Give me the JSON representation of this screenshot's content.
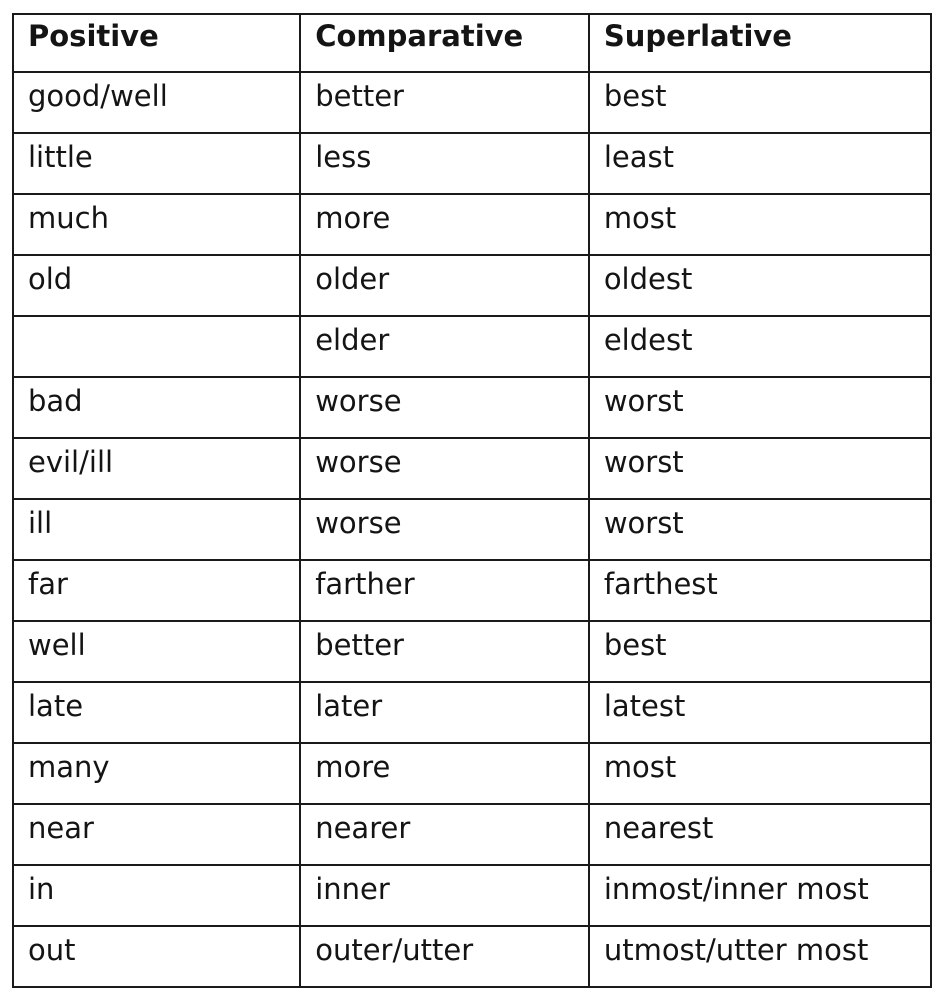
{
  "table": {
    "headers": [
      "Positive",
      "Comparative",
      "Superlative"
    ],
    "rows": [
      [
        "good/well",
        "better",
        "best"
      ],
      [
        "little",
        "less",
        "least"
      ],
      [
        "much",
        "more",
        "most"
      ],
      [
        "old",
        "older",
        "oldest"
      ],
      [
        "",
        "elder",
        "eldest"
      ],
      [
        "bad",
        "worse",
        "worst"
      ],
      [
        "evil/ill",
        "worse",
        "worst"
      ],
      [
        "ill",
        "worse",
        "worst"
      ],
      [
        "far",
        "farther",
        "farthest"
      ],
      [
        "well",
        "better",
        "best"
      ],
      [
        "late",
        "later",
        "latest"
      ],
      [
        "many",
        "more",
        "most"
      ],
      [
        "near",
        "nearer",
        "nearest"
      ],
      [
        "in",
        "inner",
        "inmost/inner most"
      ],
      [
        "out",
        "outer/utter",
        "utmost/utter most"
      ]
    ]
  }
}
